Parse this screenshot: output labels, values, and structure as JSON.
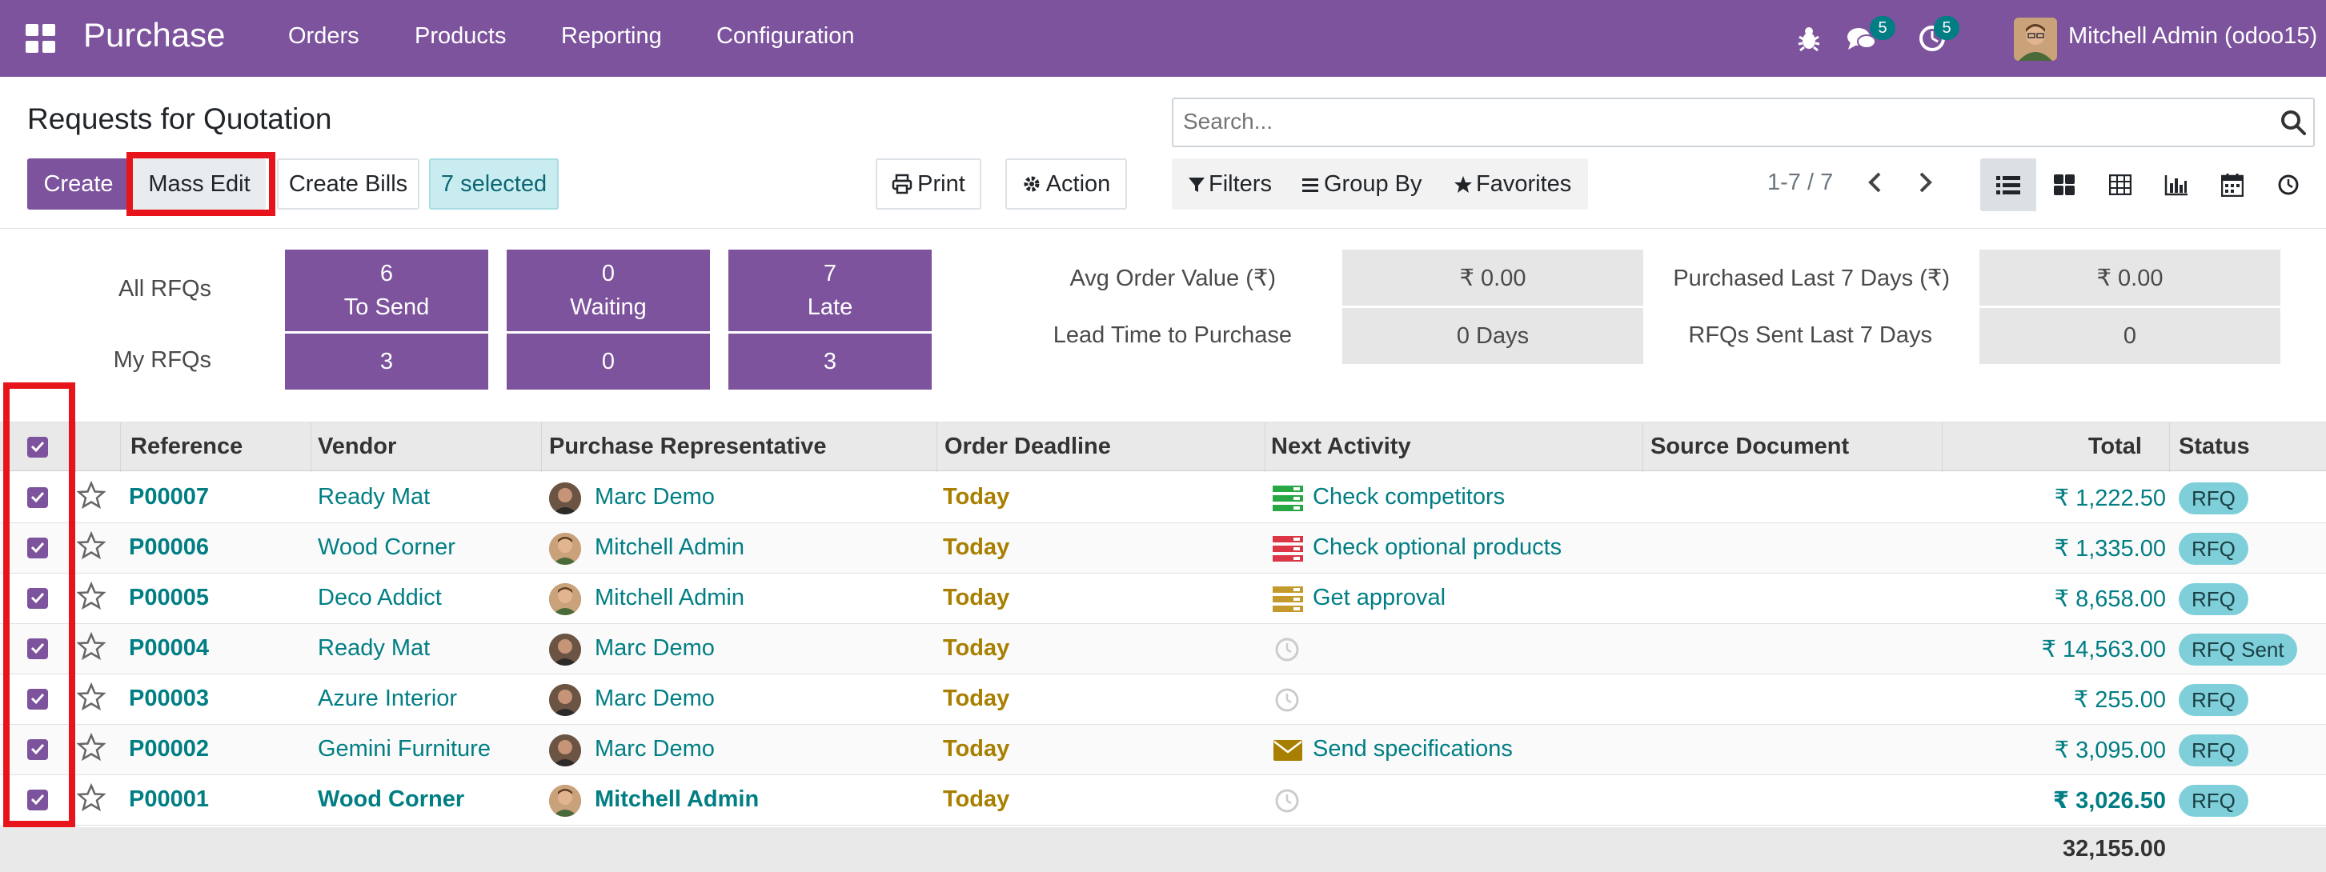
{
  "navbar": {
    "app_name": "Purchase",
    "menu": [
      "Orders",
      "Products",
      "Reporting",
      "Configuration"
    ],
    "messages_count": "5",
    "activities_count": "5",
    "user": "Mitchell Admin (odoo15)",
    "color": "#7c539c"
  },
  "page": {
    "title": "Requests for Quotation"
  },
  "toolbar": {
    "create": "Create",
    "mass_edit": "Mass Edit",
    "create_bills": "Create Bills",
    "selected": "7 selected",
    "print": "Print",
    "action": "Action"
  },
  "search": {
    "placeholder": "Search...",
    "filters": "Filters",
    "group_by": "Group By",
    "favorites": "Favorites"
  },
  "pager": {
    "value": "1-7 / 7"
  },
  "views": [
    "list-icon",
    "kanban-icon",
    "pivot-icon",
    "graph-icon",
    "calendar-icon",
    "activity-icon"
  ],
  "dashboard": {
    "all_rfqs_label": "All RFQs",
    "my_rfqs_label": "My RFQs",
    "to_send": {
      "count": "6",
      "label": "To Send"
    },
    "waiting": {
      "count": "0",
      "label": "Waiting"
    },
    "late": {
      "count": "7",
      "label": "Late"
    },
    "my_to_send": "3",
    "my_waiting": "0",
    "my_late": "3",
    "avg_order_label": "Avg Order Value (₹)",
    "avg_order_value": "₹ 0.00",
    "lead_time_label": "Lead Time to Purchase",
    "lead_time_value": "0  Days",
    "purchased_label": "Purchased Last 7 Days (₹)",
    "purchased_value": "₹ 0.00",
    "rfqs_sent_label": "RFQs Sent Last 7 Days",
    "rfqs_sent_value": "0"
  },
  "table": {
    "columns": [
      "Reference",
      "Vendor",
      "Purchase Representative",
      "Order Deadline",
      "Next Activity",
      "Source Document",
      "Total",
      "Status"
    ],
    "rows": [
      {
        "ref": "P00007",
        "vendor": "Ready Mat",
        "rep": "Marc Demo",
        "deadline": "Today",
        "activity": "Check competitors",
        "activity_icon": "green-todo-icon",
        "total": "₹ 1,222.50",
        "status": "RFQ"
      },
      {
        "ref": "P00006",
        "vendor": "Wood Corner",
        "rep": "Mitchell Admin",
        "deadline": "Today",
        "activity": "Check optional products",
        "activity_icon": "red-todo-icon",
        "total": "₹ 1,335.00",
        "status": "RFQ"
      },
      {
        "ref": "P00005",
        "vendor": "Deco Addict",
        "rep": "Mitchell Admin",
        "deadline": "Today",
        "activity": "Get approval",
        "activity_icon": "yellow-todo-icon",
        "total": "₹ 8,658.00",
        "status": "RFQ"
      },
      {
        "ref": "P00004",
        "vendor": "Ready Mat",
        "rep": "Marc Demo",
        "deadline": "Today",
        "activity": "",
        "activity_icon": "clock-icon",
        "total": "₹ 14,563.00",
        "status": "RFQ Sent"
      },
      {
        "ref": "P00003",
        "vendor": "Azure Interior",
        "rep": "Marc Demo",
        "deadline": "Today",
        "activity": "",
        "activity_icon": "clock-icon",
        "total": "₹ 255.00",
        "status": "RFQ"
      },
      {
        "ref": "P00002",
        "vendor": "Gemini Furniture",
        "rep": "Marc Demo",
        "deadline": "Today",
        "activity": "Send specifications",
        "activity_icon": "envelope-icon",
        "total": "₹ 3,095.00",
        "status": "RFQ"
      },
      {
        "ref": "P00001",
        "vendor": "Wood Corner",
        "rep": "Mitchell Admin",
        "deadline": "Today",
        "activity": "",
        "activity_icon": "clock-icon",
        "total": "₹ 3,026.50",
        "status": "RFQ"
      }
    ],
    "grand_total": "32,155.00"
  },
  "colors": {
    "primary": "#7c539c",
    "link": "#017e84",
    "deadline": "#a87f00",
    "highlight": "#e8141b",
    "status_badge": "#7ecfd9"
  }
}
